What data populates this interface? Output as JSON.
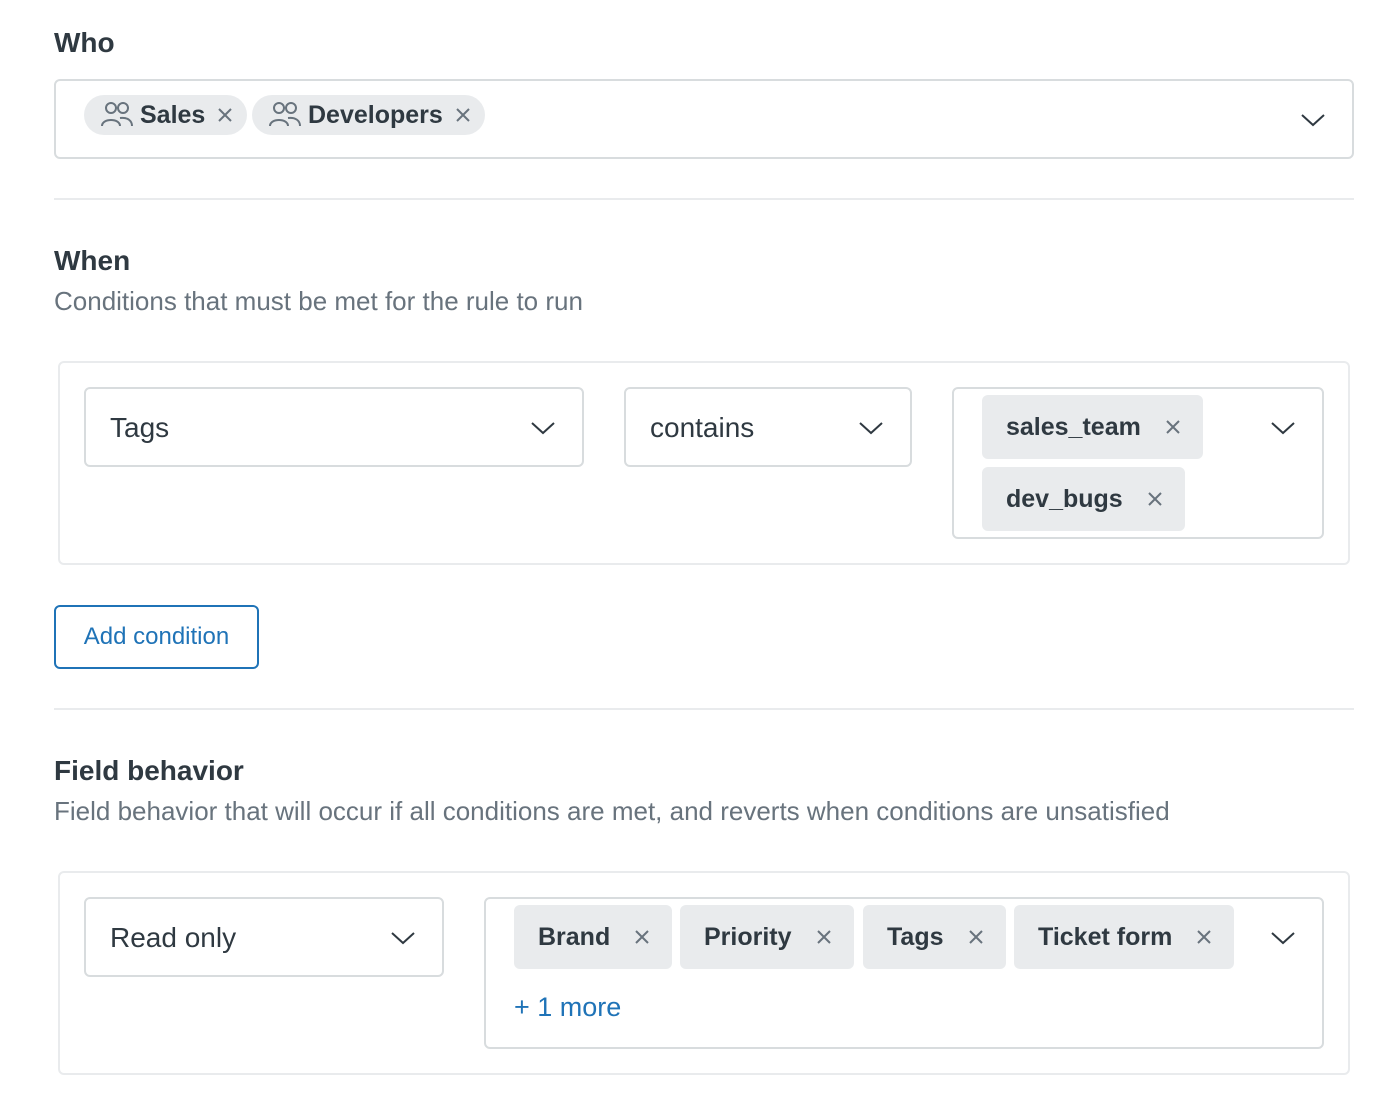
{
  "who": {
    "title": "Who",
    "groups": [
      {
        "label": "Sales",
        "icon": "users-icon"
      },
      {
        "label": "Developers",
        "icon": "users-icon"
      }
    ]
  },
  "when": {
    "title": "When",
    "description": "Conditions that must be met for the rule to run",
    "condition": {
      "field": "Tags",
      "operator": "contains",
      "values": [
        "sales_team",
        "dev_bugs"
      ]
    },
    "add_condition_label": "Add condition"
  },
  "field_behavior": {
    "title": "Field behavior",
    "description": "Field behavior that will occur if all conditions are met, and reverts when conditions are unsatisfied",
    "behavior": "Read only",
    "fields": [
      "Brand",
      "Priority",
      "Tags",
      "Ticket form"
    ],
    "more_label": "+ 1 more"
  },
  "colors": {
    "accent": "#1f73b7",
    "tag_bg": "#e9ebed",
    "border": "#d8dcde",
    "text": "#2f3941",
    "muted": "#68737d"
  }
}
